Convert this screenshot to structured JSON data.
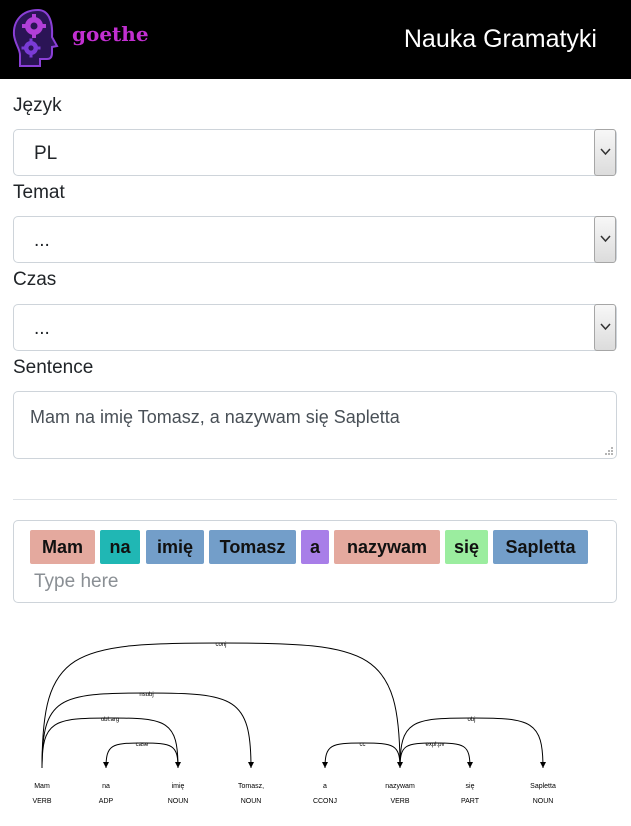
{
  "navbar": {
    "brand": "goethe",
    "title": "Nauka Gramatyki"
  },
  "form": {
    "language": {
      "label": "Język",
      "value": "PL"
    },
    "topic": {
      "label": "Temat",
      "value": "..."
    },
    "tense": {
      "label": "Czas",
      "value": "..."
    },
    "sentence": {
      "label": "Sentence",
      "value": "Mam na imię Tomasz, a nazywam się Sapletta"
    }
  },
  "tokens": {
    "items": [
      {
        "text": "Mam",
        "color": "#e4a99e"
      },
      {
        "text": "na",
        "color": "#20b7b4"
      },
      {
        "text": "imię",
        "color": "#739ec9"
      },
      {
        "text": "Tomasz",
        "color": "#739ec9"
      },
      {
        "text": "a",
        "color": "#a87ee8"
      },
      {
        "text": "nazywam",
        "color": "#e4a99e"
      },
      {
        "text": "się",
        "color": "#9bed9f"
      },
      {
        "text": "Sapletta",
        "color": "#739ec9"
      }
    ],
    "input_placeholder": "Type here"
  },
  "dependency_tree": {
    "words": [
      {
        "text": "Mam",
        "tag": "VERB"
      },
      {
        "text": "na",
        "tag": "ADP"
      },
      {
        "text": "imię",
        "tag": "NOUN"
      },
      {
        "text": "Tomasz,",
        "tag": "NOUN"
      },
      {
        "text": "a",
        "tag": "CCONJ"
      },
      {
        "text": "nazywam",
        "tag": "VERB"
      },
      {
        "text": "się",
        "tag": "PART"
      },
      {
        "text": "Sapletta",
        "tag": "NOUN"
      }
    ],
    "arcs": [
      {
        "from": 0,
        "to": 5,
        "label": "conj"
      },
      {
        "from": 0,
        "to": 3,
        "label": "nsubj"
      },
      {
        "from": 0,
        "to": 2,
        "label": "obl:arg"
      },
      {
        "from": 2,
        "to": 1,
        "label": "case"
      },
      {
        "from": 5,
        "to": 4,
        "label": "cc"
      },
      {
        "from": 5,
        "to": 6,
        "label": "expl:pv"
      },
      {
        "from": 5,
        "to": 7,
        "label": "obj"
      }
    ]
  }
}
